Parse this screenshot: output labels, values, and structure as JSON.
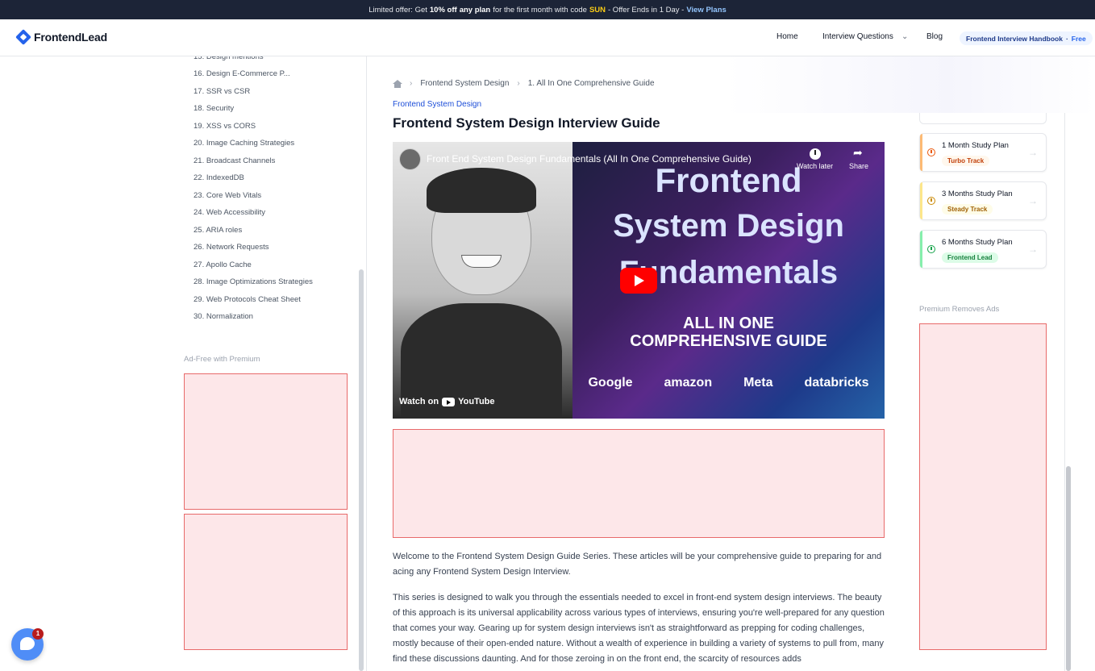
{
  "promo": {
    "prefix": "Limited offer: Get",
    "discount": "10% off",
    "middle": "any plan",
    "suffix": "for the first month with code",
    "code": "SUN",
    "ends": "- Offer Ends in 1 Day -",
    "link": "View Plans"
  },
  "header": {
    "logo": "FrontendLead",
    "nav": [
      "Home",
      "Interview Questions",
      "Blog"
    ],
    "handbook": "Frontend Interview Handbook",
    "handbook_sep": "·",
    "handbook_free": "Free"
  },
  "toc": {
    "items": [
      "15. Design mentions",
      "16. Design E-Commerce P...",
      "17. SSR vs CSR",
      "18. Security",
      "19. XSS vs CORS",
      "20. Image Caching Strategies",
      "21. Broadcast Channels",
      "22. IndexedDB",
      "23. Core Web Vitals",
      "24. Web Accessibility",
      "25. ARIA roles",
      "26. Network Requests",
      "27. Apollo Cache",
      "28. Image Optimizations Strategies",
      "29. Web Protocols Cheat Sheet",
      "30. Normalization"
    ]
  },
  "ads": {
    "left_label": "Ad-Free with Premium",
    "right_label": "Premium Removes Ads"
  },
  "breadcrumb": {
    "items": [
      "Frontend System Design",
      "1. All In One Comprehensive Guide"
    ]
  },
  "article": {
    "category": "Frontend System Design",
    "title": "Frontend System Design Interview Guide",
    "para1": "Welcome to the Frontend System Design Guide Series. These articles will be your comprehensive guide to preparing for and acing any Frontend System Design Interview.",
    "para2": "This series is designed to walk you through the essentials needed to excel in front-end system design interviews. The beauty of this approach is its universal applicability across various types of interviews, ensuring you're well-prepared for any question that comes your way. Gearing up for system design interviews isn't as straightforward as prepping for coding challenges, mostly because of their open-ended nature. Without a wealth of experience in building a variety of systems to pull from, many find these discussions daunting. And for those zeroing in on the front end, the scarcity of resources adds"
  },
  "video": {
    "title": "Front End System Design Fundamentals (All In One Comprehensive Guide)",
    "watch_later": "Watch later",
    "share": "Share",
    "headline1": "Frontend",
    "headline2": "System Design",
    "headline3": "Fundamentals",
    "sub1": "ALL IN ONE",
    "sub2": "COMPREHENSIVE GUIDE",
    "brands": [
      "Google",
      "amazon",
      "Meta",
      "databricks"
    ],
    "watch_on": "Watch on",
    "yt": "YouTube"
  },
  "plans": [
    {
      "title": "1 Month Study Plan",
      "badge": "Turbo Track",
      "color": "#c2410c",
      "bg": "#fff7ed",
      "bar": "#fdba74"
    },
    {
      "title": "3 Months Study Plan",
      "badge": "Steady Track",
      "color": "#a16207",
      "bg": "#fefce8",
      "bar": "#fde68a"
    },
    {
      "title": "6 Months Study Plan",
      "badge": "Frontend Lead",
      "color": "#15803d",
      "bg": "#dcfce7",
      "bar": "#86efac"
    }
  ],
  "chat": {
    "badge": "1"
  }
}
